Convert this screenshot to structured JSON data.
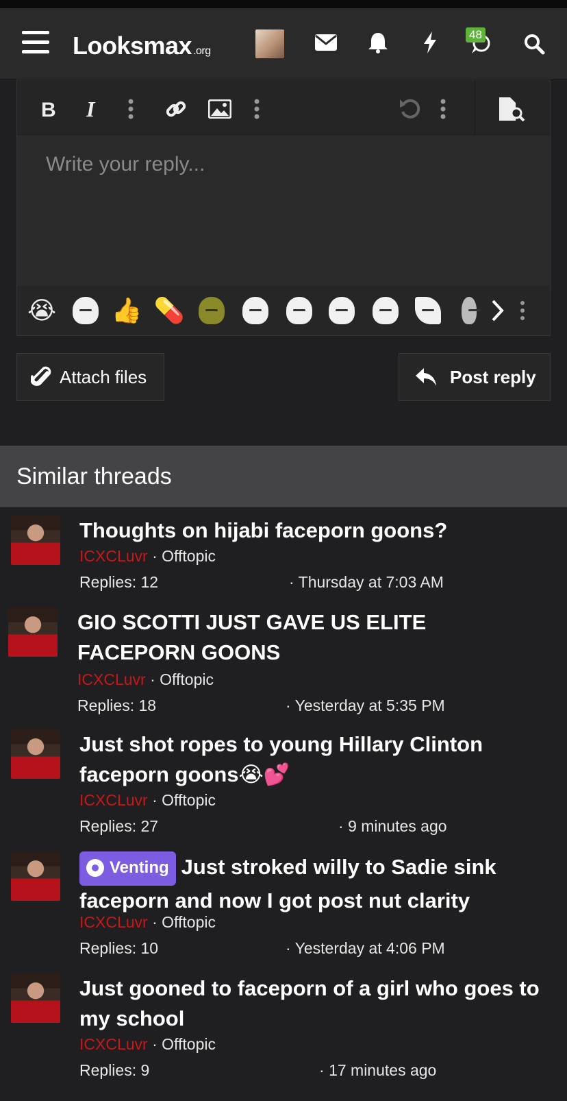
{
  "header": {
    "logo_main": "Looksmax",
    "logo_suffix": ".org",
    "notification_count": "48",
    "icons": [
      "menu-icon",
      "avatar",
      "mail-icon",
      "bell-icon",
      "bolt-icon",
      "chat-icon",
      "search-icon"
    ]
  },
  "editor": {
    "placeholder": "Write your reply...",
    "toolbar_icons": [
      "bold-icon",
      "italic-icon",
      "more-vertical-icon",
      "link-icon",
      "image-icon",
      "more-vertical-icon",
      "undo-icon",
      "more-vertical-icon",
      "preview-icon"
    ],
    "emojis": [
      "😭",
      "wojak",
      "👍",
      "💊",
      "shrek",
      "wojak",
      "wojak",
      "wojak",
      "wojak",
      "wojak",
      "wojak"
    ]
  },
  "actions": {
    "attach_label": "Attach files",
    "post_label": "Post reply"
  },
  "similar": {
    "heading": "Similar threads",
    "threads": [
      {
        "tag": "",
        "title": "Thoughts on hijabi faceporn goons?",
        "author": "ICXCLuvr",
        "forum": "Offtopic",
        "replies": "Replies: 12",
        "date": "Thursday at 7:03 AM"
      },
      {
        "tag": "",
        "title": "GIO SCOTTI JUST GAVE US ELITE FACEPORN GOONS",
        "author": "ICXCLuvr",
        "forum": "Offtopic",
        "replies": "Replies: 18",
        "date": "Yesterday at 5:35 PM"
      },
      {
        "tag": "",
        "title": "Just shot ropes to young Hillary Clinton faceporn goons😭💕",
        "author": "ICXCLuvr",
        "forum": "Offtopic",
        "replies": "Replies: 27",
        "date": "9 minutes ago"
      },
      {
        "tag": "Venting",
        "title": "Just stroked willy to Sadie sink faceporn and now I got post nut clarity",
        "author": "ICXCLuvr",
        "forum": "Offtopic",
        "replies": "Replies: 10",
        "date": "Yesterday at 4:06 PM"
      },
      {
        "tag": "",
        "title": "Just gooned to faceporn of a girl who goes to my school",
        "author": "ICXCLuvr",
        "forum": "Offtopic",
        "replies": "Replies: 9",
        "date": "17 minutes ago"
      }
    ]
  }
}
